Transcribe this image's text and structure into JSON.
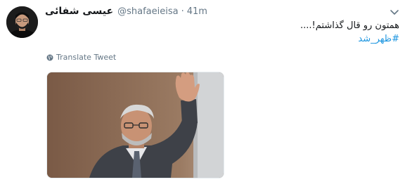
{
  "tweet": {
    "display_name": "عیسی شفائی",
    "handle": "@shafaeieisa",
    "separator": "·",
    "time": "41m",
    "text": "همتون رو قال گذاشتم!....",
    "hashtag": "#ظهر_شد",
    "translate_label": "Translate Tweet"
  },
  "colors": {
    "link": "#1b95e0",
    "secondary_text": "#657786",
    "primary_text": "#14171a"
  },
  "icons": {
    "caret": "chevron-down-icon",
    "translate": "globe-icon"
  }
}
